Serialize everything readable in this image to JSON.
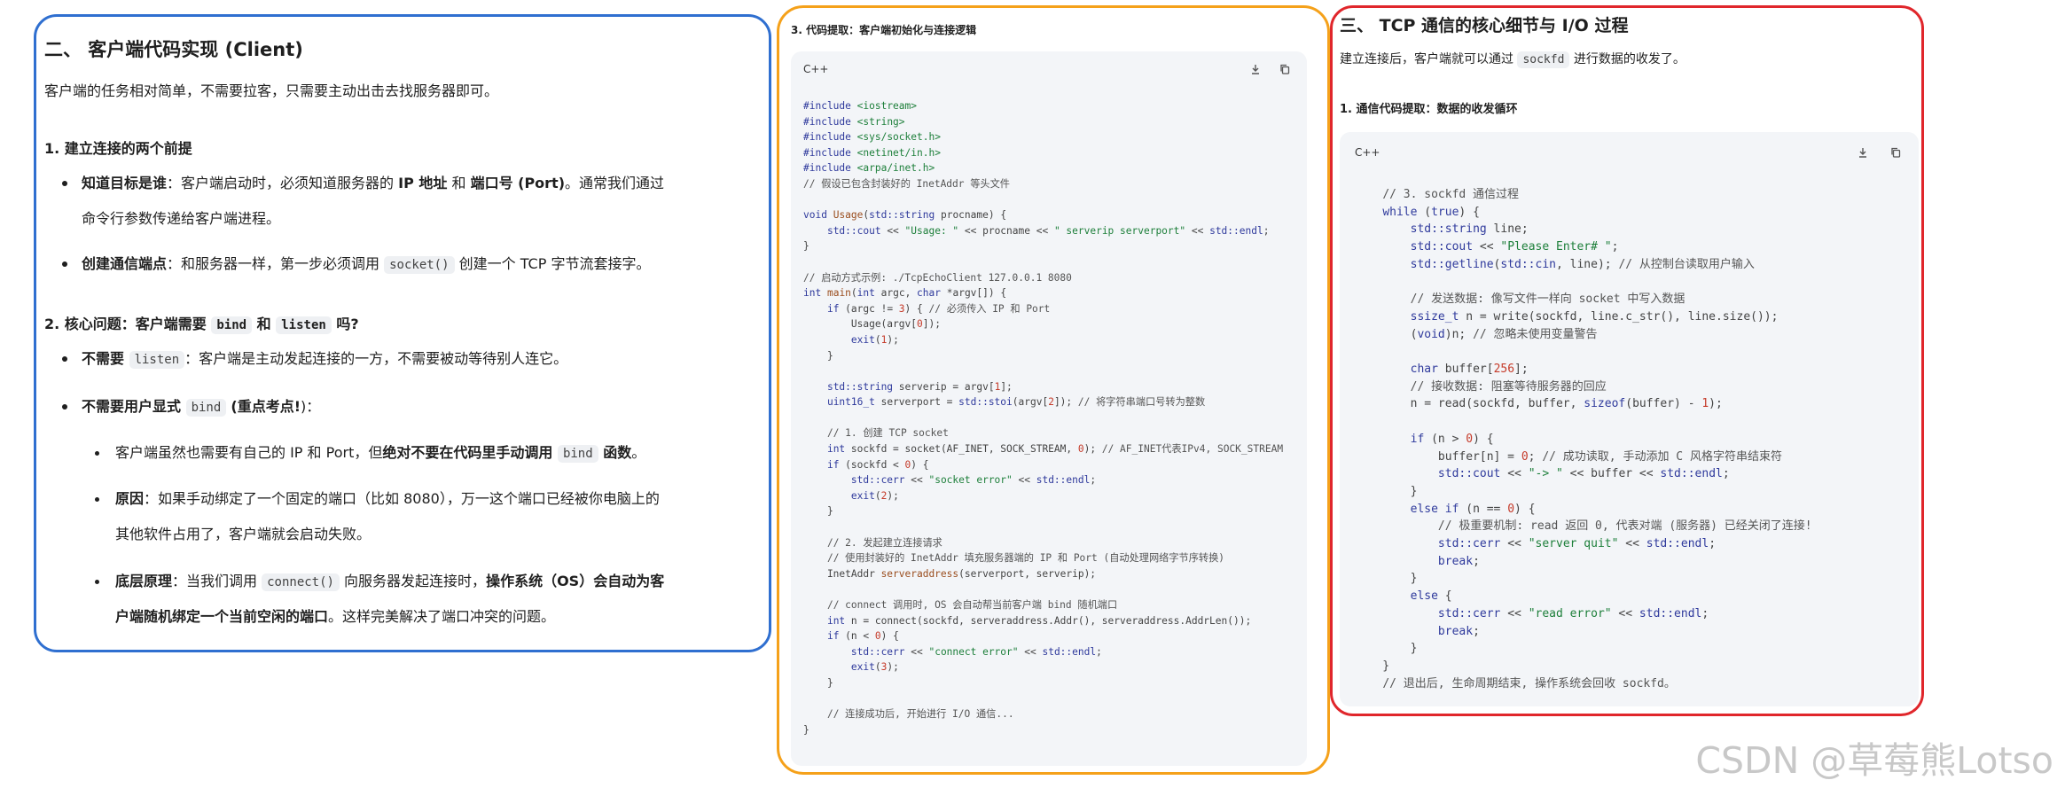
{
  "client": {
    "title": "二、 客户端代码实现 (Client)",
    "intro": "客户端的任务相对简单，不需要拉客，只需要主动出击去找服务器即可。",
    "s1_title": "1. 建立连接的两个前提",
    "s1_b1_bold1": "知道目标是谁",
    "s1_b1_t1": "：客户端启动时，必须知道服务器的 ",
    "s1_b1_bold2": "IP 地址",
    "s1_b1_t2": " 和 ",
    "s1_b1_bold3": "端口号 (Port)",
    "s1_b1_t3": "。通常我们通过",
    "s1_b1_line2": "命令行参数传递给客户端进程。",
    "s1_b2_bold": "创建通信端点",
    "s1_b2_t1": "：和服务器一样，第一步必须调用 ",
    "s1_b2_code": "socket()",
    "s1_b2_t2": " 创建一个 TCP 字节流套接字。",
    "s2_t1": "2. 核心问题：客户端需要 ",
    "s2_code1": "bind",
    "s2_t2": " 和 ",
    "s2_code2": "listen",
    "s2_t3": " 吗?",
    "s2_b1_bold": "不需要 ",
    "s2_b1_code": "listen",
    "s2_b1_t": "：客户端是主动发起连接的一方，不需要被动等待别人连它。",
    "s2_b2_bold": "不需要用户显式 ",
    "s2_b2_code": "bind",
    "s2_b2_t1": " ",
    "s2_b2_bold2": "(重点考点!",
    "s2_b2_t2": ")：",
    "s2_sb1_t1": "客户端虽然也需要有自己的 IP 和 Port，但",
    "s2_sb1_bold": "绝对不要在代码里手动调用 ",
    "s2_sb1_code": "bind",
    "s2_sb1_bold2": " 函数",
    "s2_sb1_t2": "。",
    "s2_sb2_bold": "原因",
    "s2_sb2_t": "：如果手动绑定了一个固定的端口（比如 8080），万一这个端口已经被你电脑上的",
    "s2_sb2_line2": "其他软件占用了，客户端就会启动失败。",
    "s2_sb3_bold": "底层原理",
    "s2_sb3_t1": "：当我们调用 ",
    "s2_sb3_code": "connect()",
    "s2_sb3_t2": " 向服务器发起连接时，",
    "s2_sb3_bold2": "操作系统（OS）会自动为客",
    "s2_sb3_line2_bold": "户端随机绑定一个当前空闲的端口",
    "s2_sb3_line2_t": "。这样完美解决了端口冲突的问题。"
  },
  "code_panel": {
    "title": "3. 代码提取：客户端初始化与连接逻辑",
    "lang": "C++"
  },
  "tcp": {
    "title": "三、 TCP 通信的核心细节与 I/O 过程",
    "intro_t1": "建立连接后，客户端就可以通过 ",
    "intro_code": "sockfd",
    "intro_t2": " 进行数据的收发了。",
    "s1_title": "1. 通信代码提取：数据的收发循环",
    "lang": "C++"
  },
  "watermark": "CSDN @草莓熊Lotso",
  "icons": {
    "download": "download-icon",
    "copy": "copy-icon"
  },
  "colors": {
    "client_border": "#2f6fd0",
    "code_border": "#f5a11a",
    "tcp_border": "#e0262b"
  }
}
